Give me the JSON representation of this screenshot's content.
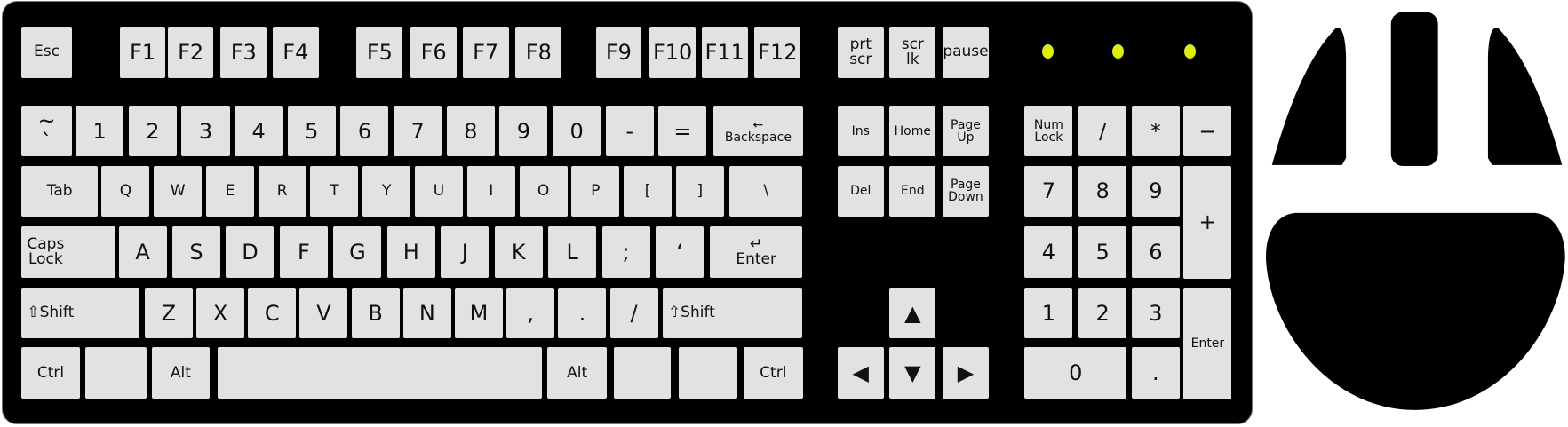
{
  "keyboard": {
    "function_row": [
      "Esc",
      "F1",
      "F2",
      "F3",
      "F4",
      "F5",
      "F6",
      "F7",
      "F8",
      "F9",
      "F10",
      "F11",
      "F12"
    ],
    "system_keys": [
      "prt\nscr",
      "scr\nlk",
      "pause"
    ],
    "number_row": [
      "~\n`",
      "1",
      "2",
      "3",
      "4",
      "5",
      "6",
      "7",
      "8",
      "9",
      "0",
      "-",
      "=",
      "← \nBackspace"
    ],
    "tab_row": [
      "Tab",
      "Q",
      "W",
      "E",
      "R",
      "T",
      "Y",
      "U",
      "I",
      "O",
      "P",
      "[",
      "]",
      "\\"
    ],
    "caps_row": [
      "Caps\nLock",
      "A",
      "S",
      "D",
      "F",
      "G",
      "H",
      "J",
      "K",
      "L",
      ";",
      "‘",
      "↵\nEnter"
    ],
    "shift_row": [
      "⇧Shift",
      "Z",
      "X",
      "C",
      "V",
      "B",
      "N",
      "M",
      ",",
      ".",
      "/",
      "⇧Shift"
    ],
    "bottom_row": [
      "Ctrl",
      "",
      "Alt",
      "",
      "Alt",
      "",
      "",
      "Ctrl"
    ],
    "nav_keys": [
      "Ins",
      "Home",
      "Page\nUp",
      "Del",
      "End",
      "Page\nDown"
    ],
    "arrow_keys": [
      "▲",
      "◀",
      "▼",
      "▶"
    ],
    "numpad": [
      "Num\nLock",
      "/",
      "*",
      "−",
      "7",
      "8",
      "9",
      "+",
      "4",
      "5",
      "6",
      "1",
      "2",
      "3",
      "Enter",
      "0",
      "."
    ],
    "led_color": "#ddf000",
    "key_color": "#e2e2e0",
    "body_color": "#000000"
  },
  "mouse": {
    "buttons": [
      "left-button",
      "middle-button",
      "right-button"
    ],
    "color": "#000000"
  }
}
